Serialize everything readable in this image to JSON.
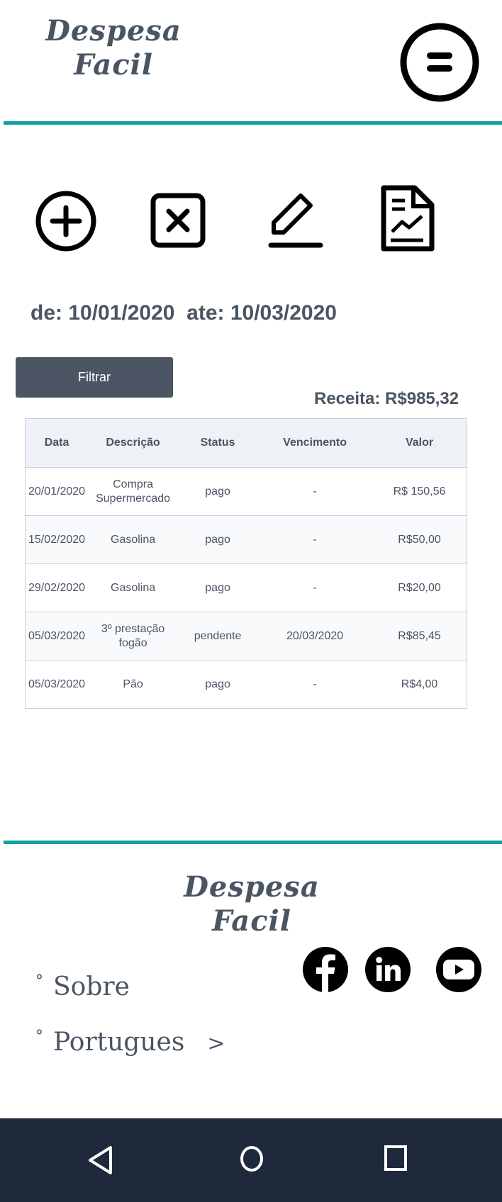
{
  "header": {
    "logo_line1": "Despesa",
    "logo_line2": "Facil",
    "menu_icon": "menu-circle-icon"
  },
  "toolbar": {
    "icons": [
      "add-circle-icon",
      "delete-square-icon",
      "edit-pencil-icon",
      "report-chart-icon"
    ]
  },
  "filter": {
    "range_text": "de: 10/01/2020  ate: 10/03/2020",
    "button_label": "Filtrar"
  },
  "receita": "Receita: R$985,32",
  "table": {
    "headers": [
      "Data",
      "Descrição",
      "Status",
      "Vencimento",
      "Valor"
    ],
    "rows": [
      [
        "20/01/2020",
        "Compra Supermercado",
        "pago",
        "-",
        "R$ 150,56"
      ],
      [
        "15/02/2020",
        "Gasolina",
        "pago",
        "-",
        "R$50,00"
      ],
      [
        "29/02/2020",
        "Gasolina",
        "pago",
        "-",
        "R$20,00"
      ],
      [
        "05/03/2020",
        "3º prestação fogão",
        "pendente",
        "20/03/2020",
        "R$85,45"
      ],
      [
        "05/03/2020",
        "Pão",
        "pago",
        "-",
        "R$4,00"
      ]
    ]
  },
  "footer": {
    "logo_line1": "Despesa",
    "logo_line2": "Facil",
    "bullet": "°",
    "links": {
      "sobre": "Sobre",
      "language": "Portugues",
      "language_arrow": ">"
    },
    "social": [
      "facebook-icon",
      "linkedin-icon",
      "youtube-icon"
    ]
  },
  "colors": {
    "accent": "#159f9c",
    "text": "#4a5563",
    "button": "#4b5563",
    "navbar": "#1e293b"
  }
}
